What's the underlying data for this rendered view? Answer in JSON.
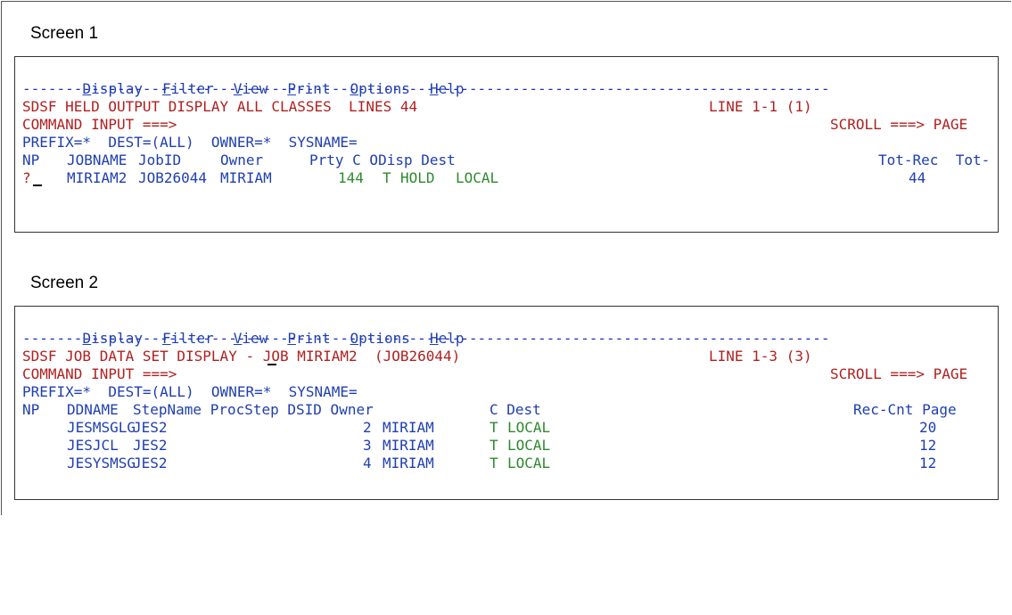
{
  "screens": [
    {
      "label": "Screen 1",
      "menu": [
        "Display",
        "Filter",
        "View",
        "Print",
        "Options",
        "Help"
      ],
      "divider": "----------------------------------------------------------------------------------------------",
      "title": "SDSF HELD OUTPUT DISPLAY ALL CLASSES  LINES 44",
      "line_info": "LINE 1-1 (1)",
      "command_label": "COMMAND INPUT ===>",
      "scroll_label": "SCROLL ===> PAGE",
      "prefix_line": "PREFIX=*  DEST=(ALL)  OWNER=*  SYSNAME=",
      "headers": {
        "np": "NP",
        "col1": "JOBNAME",
        "col2": "JobID",
        "col3": "Owner",
        "col4": "Prty C ODisp Dest",
        "col5": "Tot-Rec  Tot-"
      },
      "rows": [
        {
          "np": "?",
          "jobname": "MIRIAM2",
          "jobid": "JOB26044",
          "owner": "MIRIAM",
          "prty": "144",
          "cls": "T",
          "odisp": "HOLD",
          "dest": "LOCAL",
          "totrec": "44"
        }
      ]
    },
    {
      "label": "Screen 2",
      "menu": [
        "Display",
        "Filter",
        "View",
        "Print",
        "Options",
        "Help"
      ],
      "divider": "----------------------------------------------------------------------------------------------",
      "title": "SDSF JOB DATA SET DISPLAY - JOB MIRIAM2  (JOB26044)",
      "line_info": "LINE 1-3 (3)",
      "command_label": "COMMAND INPUT ===>",
      "scroll_label": "SCROLL ===> PAGE",
      "prefix_line": "PREFIX=*  DEST=(ALL)  OWNER=*  SYSNAME=",
      "headers": {
        "np": "NP",
        "col1": "DDNAME",
        "col2": "StepName ProcStep DSID Owner",
        "col3": "C Dest",
        "col4": "Rec-Cnt Page"
      },
      "rows": [
        {
          "ddname": "JESMSGLG",
          "stepname": "JES2",
          "dsid": "2",
          "owner": "MIRIAM",
          "cls": "T",
          "dest": "LOCAL",
          "reccnt": "20"
        },
        {
          "ddname": "JESJCL",
          "stepname": "JES2",
          "dsid": "3",
          "owner": "MIRIAM",
          "cls": "T",
          "dest": "LOCAL",
          "reccnt": "12"
        },
        {
          "ddname": "JESYSMSG",
          "stepname": "JES2",
          "dsid": "4",
          "owner": "MIRIAM",
          "cls": "T",
          "dest": "LOCAL",
          "reccnt": "12"
        }
      ]
    }
  ]
}
